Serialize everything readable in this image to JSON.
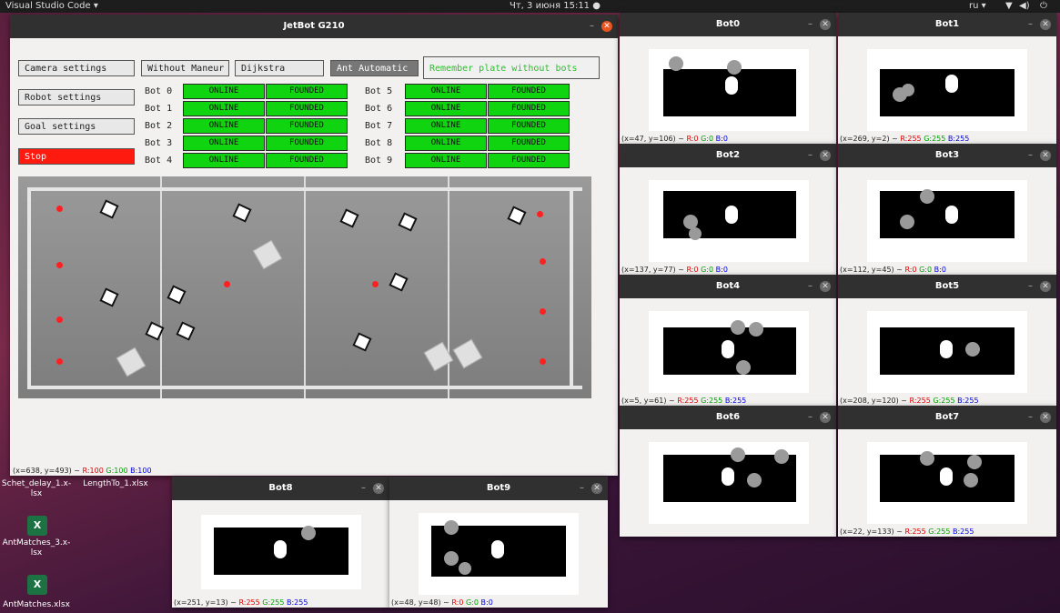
{
  "topbar": {
    "app": "Visual Studio Code ▾",
    "clock": "Чт, 3 июня 15:11 ●",
    "lang": "ru ▾"
  },
  "main": {
    "title": "JetBot G210",
    "buttons": {
      "camera": "Camera settings",
      "without": "Without Maneur",
      "dijkstra": "Dijkstra",
      "ant": "Ant Automatic",
      "remember": "Remember plate without bots",
      "robot": "Robot settings",
      "goal": "Goal settings",
      "stop": "Stop"
    },
    "bots_left": [
      {
        "name": "Bot 0",
        "status": "ONLINE",
        "state": "FOUNDED"
      },
      {
        "name": "Bot 1",
        "status": "ONLINE",
        "state": "FOUNDED"
      },
      {
        "name": "Bot 2",
        "status": "ONLINE",
        "state": "FOUNDED"
      },
      {
        "name": "Bot 3",
        "status": "ONLINE",
        "state": "FOUNDED"
      },
      {
        "name": "Bot 4",
        "status": "ONLINE",
        "state": "FOUNDED"
      }
    ],
    "bots_right": [
      {
        "name": "Bot 5",
        "status": "ONLINE",
        "state": "FOUNDED"
      },
      {
        "name": "Bot 6",
        "status": "ONLINE",
        "state": "FOUNDED"
      },
      {
        "name": "Bot 7",
        "status": "ONLINE",
        "state": "FOUNDED"
      },
      {
        "name": "Bot 8",
        "status": "ONLINE",
        "state": "FOUNDED"
      },
      {
        "name": "Bot 9",
        "status": "ONLINE",
        "state": "FOUNDED"
      }
    ],
    "status": {
      "coords": "(x=638, y=493) ~",
      "r": "R:100",
      "g": "G:100",
      "b": "B:100"
    }
  },
  "botwins": [
    {
      "title": "Bot0",
      "coords": "(x=47, y=106) ~",
      "r": "R:0",
      "g": "G:0",
      "b": "B:0"
    },
    {
      "title": "Bot1",
      "coords": "(x=269, y=2) ~",
      "r": "R:255",
      "g": "G:255",
      "b": "B:255"
    },
    {
      "title": "Bot2",
      "coords": "(x=137, y=77) ~",
      "r": "R:0",
      "g": "G:0",
      "b": "B:0"
    },
    {
      "title": "Bot3",
      "coords": "(x=112, y=45) ~",
      "r": "R:0",
      "g": "G:0",
      "b": "B:0"
    },
    {
      "title": "Bot4",
      "coords": "(x=5, y=61) ~",
      "r": "R:255",
      "g": "G:255",
      "b": "B:255"
    },
    {
      "title": "Bot5",
      "coords": "(x=208, y=120) ~",
      "r": "R:255",
      "g": "G:255",
      "b": "B:255"
    },
    {
      "title": "Bot6",
      "coords": "",
      "r": "",
      "g": "",
      "b": ""
    },
    {
      "title": "Bot7",
      "coords": "(x=22, y=133) ~",
      "r": "R:255",
      "g": "G:255",
      "b": "B:255"
    },
    {
      "title": "Bot8",
      "coords": "(x=251, y=13) ~",
      "r": "R:255",
      "g": "G:255",
      "b": "B:255"
    },
    {
      "title": "Bot9",
      "coords": "(x=48, y=48) ~",
      "r": "R:0",
      "g": "G:0",
      "b": "B:0"
    }
  ],
  "desktop": {
    "file1": "Schet_delay_1.x-lsx",
    "file2": "LengthTo_1.xlsx",
    "file3": "AntMatches_3.x-lsx",
    "file4": "AntMatches.xlsx"
  }
}
